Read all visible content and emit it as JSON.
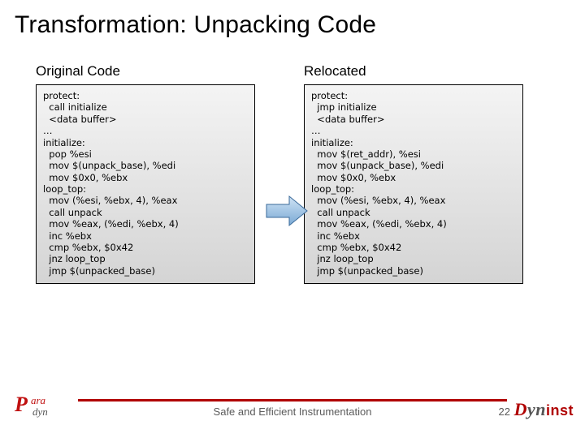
{
  "title": "Transformation: Unpacking Code",
  "left": {
    "heading": "Original Code",
    "code": "protect:\n  call initialize\n  <data buffer>\n…\ninitialize:\n  pop %esi\n  mov $(unpack_base), %edi\n  mov $0x0, %ebx\nloop_top:\n  mov (%esi, %ebx, 4), %eax\n  call unpack\n  mov %eax, (%edi, %ebx, 4)\n  inc %ebx\n  cmp %ebx, $0x42\n  jnz loop_top\n  jmp $(unpacked_base)"
  },
  "right": {
    "heading": "Relocated",
    "code": "protect:\n  jmp initialize\n  <data buffer>\n…\ninitialize:\n  mov $(ret_addr), %esi\n  mov $(unpack_base), %edi\n  mov $0x0, %ebx\nloop_top:\n  mov (%esi, %ebx, 4), %eax\n  call unpack\n  mov %eax, (%edi, %ebx, 4)\n  inc %ebx\n  cmp %ebx, $0x42\n  jnz loop_top\n  jmp $(unpacked_base)"
  },
  "footer": {
    "caption": "Safe and Efficient Instrumentation",
    "page": "22"
  },
  "logos": {
    "left_main": "P",
    "left_top": "ara",
    "left_bottom": "dyn",
    "right_d": "D",
    "right_yn": "yn",
    "right_inst": "inst"
  }
}
